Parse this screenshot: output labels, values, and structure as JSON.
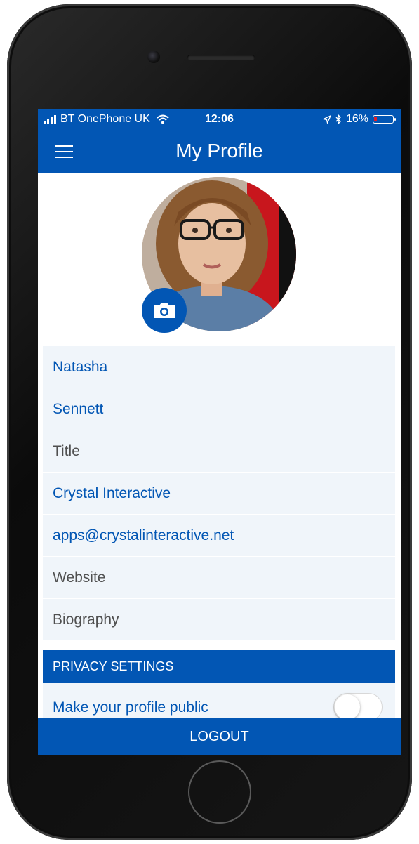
{
  "status_bar": {
    "carrier": "BT OnePhone UK",
    "time": "12:06",
    "battery": "16%",
    "battery_level": 0.16,
    "icons": [
      "signal-bars-icon",
      "wifi-icon",
      "location-arrow-icon",
      "bluetooth-icon",
      "battery-icon"
    ]
  },
  "header": {
    "title": "My Profile",
    "menu_icon": "hamburger-menu-icon"
  },
  "profile": {
    "camera_icon": "camera-icon"
  },
  "fields": [
    {
      "name": "first-name",
      "value": "Natasha",
      "filled": true
    },
    {
      "name": "last-name",
      "value": "Sennett",
      "filled": true
    },
    {
      "name": "title",
      "value": "Title",
      "filled": false
    },
    {
      "name": "company",
      "value": "Crystal Interactive",
      "filled": true
    },
    {
      "name": "email",
      "value": "apps@crystalinteractive.net",
      "filled": true
    },
    {
      "name": "website",
      "value": "Website",
      "filled": false
    },
    {
      "name": "biography",
      "value": "Biography",
      "filled": false
    }
  ],
  "privacy": {
    "header": "PRIVACY SETTINGS",
    "public_label": "Make your profile public",
    "public_enabled": false
  },
  "footer": {
    "logout_label": "LOGOUT"
  },
  "colors": {
    "brand_blue": "#0256b4",
    "field_bg": "#f0f5fa",
    "placeholder_text": "#4f4f4f",
    "battery_low": "#e51c23"
  }
}
